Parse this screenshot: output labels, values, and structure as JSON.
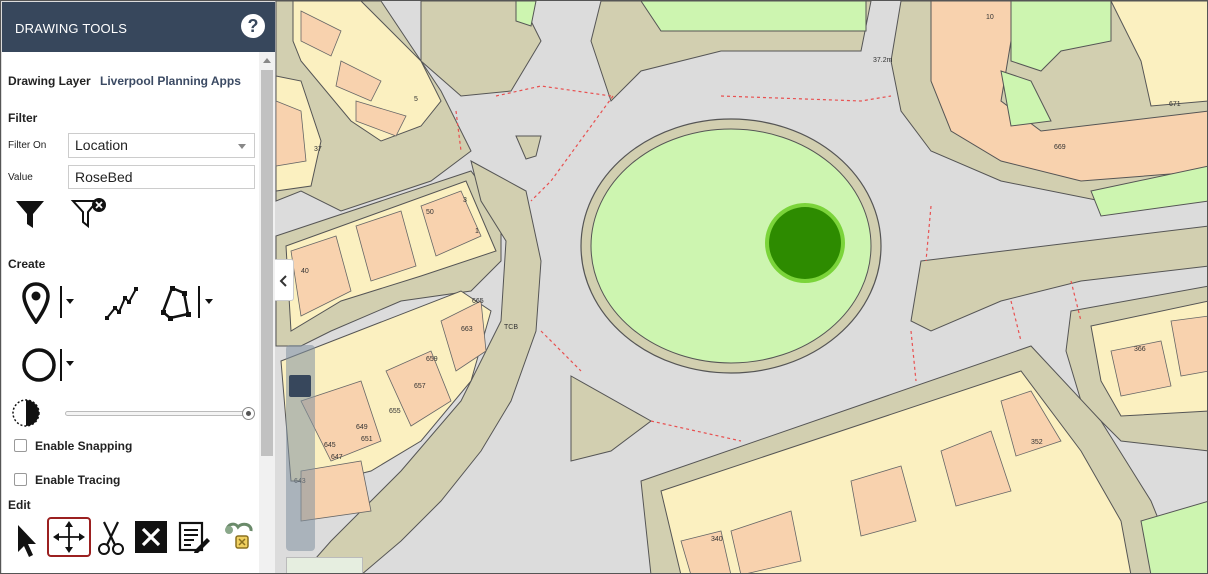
{
  "panel": {
    "title": "DRAWING TOOLS",
    "help_icon": "question-mark-icon",
    "drawing_layer_label": "Drawing Layer",
    "drawing_layer_value": "Liverpool Planning Apps",
    "filter_heading": "Filter",
    "filter_on_label": "Filter On",
    "filter_on_value": "Location",
    "value_label": "Value",
    "value_input": "RoseBed",
    "create_heading": "Create",
    "enable_snapping": "Enable Snapping",
    "enable_tracing": "Enable Tracing",
    "edit_heading": "Edit"
  },
  "icons": {
    "filter": "filter-icon",
    "clear_filter": "clear-filter-icon",
    "point": "map-pin-icon",
    "line": "polyline-icon",
    "polygon": "polygon-icon",
    "circle": "circle-icon",
    "opacity": "contrast-icon",
    "select": "pointer-icon",
    "move": "move-icon",
    "cut": "scissors-icon",
    "delete": "delete-icon",
    "attributes": "edit-attributes-icon",
    "other": "node-edit-icon"
  },
  "map": {
    "labels": {
      "height": "37.2m",
      "tcb": "TCB",
      "n10": "10",
      "n671": "671",
      "n669": "669",
      "n37": "37",
      "n5": "5",
      "n3": "3",
      "n50": "50",
      "n1": "1",
      "n40": "40",
      "n665": "665",
      "n663": "663",
      "n659": "659",
      "n657": "657",
      "n655": "655",
      "n649": "649",
      "n651": "651",
      "n645": "645",
      "n647": "647",
      "n643": "643",
      "n366": "366",
      "n352": "352",
      "n340": "340"
    },
    "colors": {
      "road": "#dcdcdc",
      "verge": "#d2cfb0",
      "grass": "#cdf5b0",
      "building_yellow": "#fbf0c0",
      "building_orange": "#f8d2ae",
      "rosebed": "#2d8b00",
      "rosebed_ring": "#7bd43a",
      "boundary": "#e85050"
    },
    "zoom_level": 0.85
  }
}
